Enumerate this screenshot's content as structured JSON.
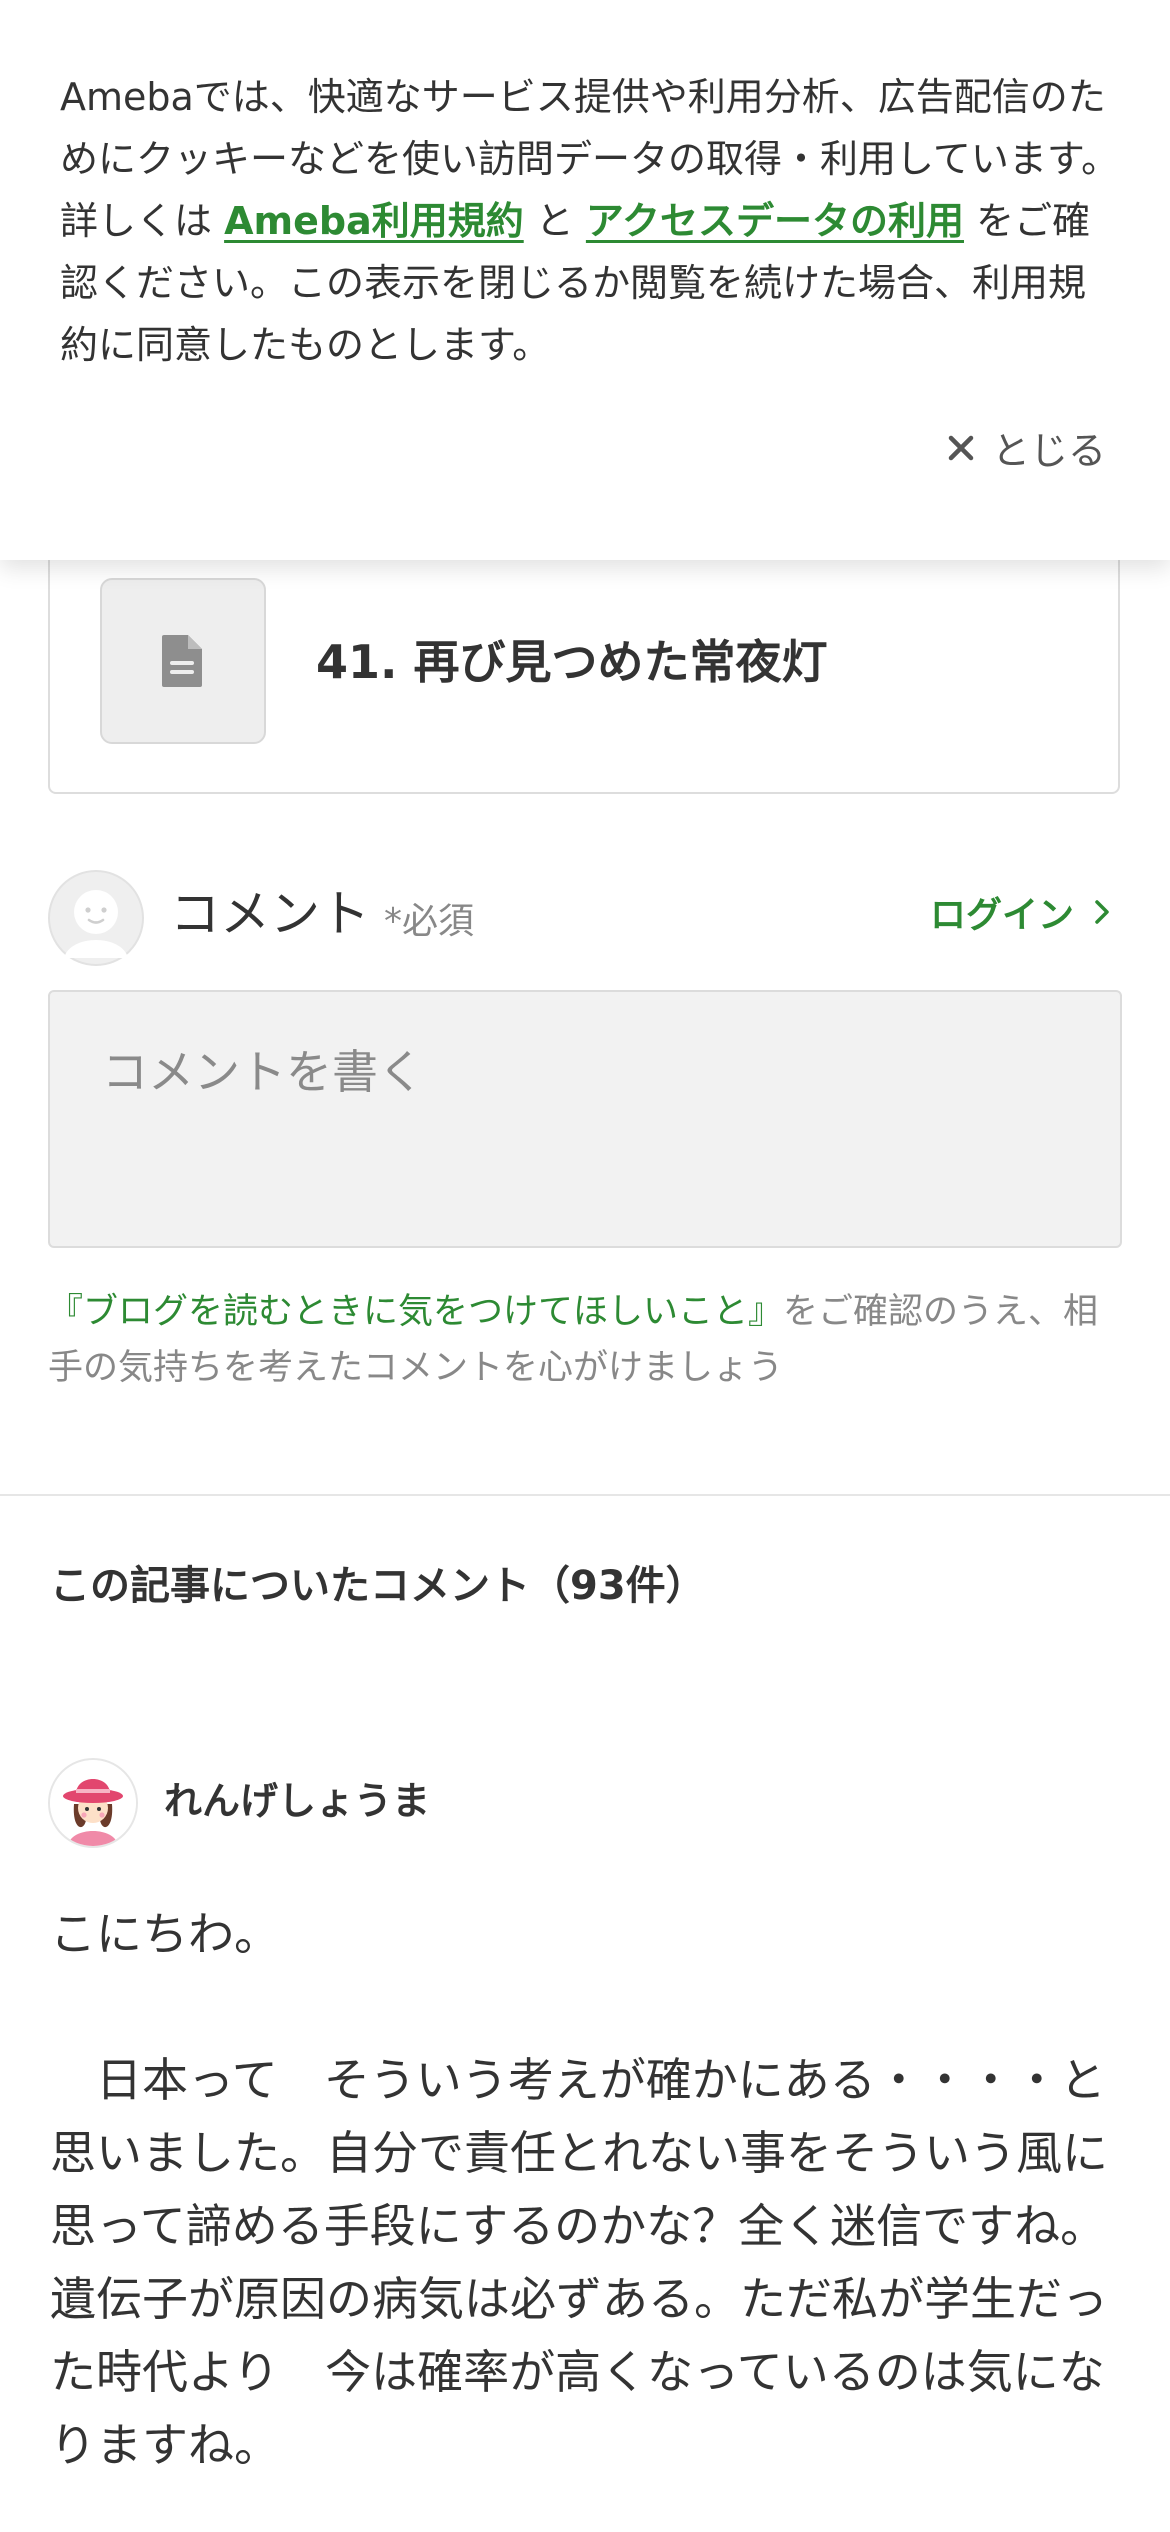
{
  "cookie_banner": {
    "text_before": "Amebaでは、快適なサービス提供や利用分析、広告配信のためにクッキーなどを使い訪問データの取得・利用しています。詳しくは ",
    "terms_link": "Ameba利用規約",
    "text_middle": " と ",
    "data_link": "アクセスデータの利用",
    "text_after": " をご確認ください。この表示を閉じるか閲覧を続けた場合、利用規約に同意したものとします。",
    "close_label": "とじる"
  },
  "related_article": {
    "title": "41. 再び見つめた常夜灯",
    "icon": "document-icon"
  },
  "comment_form": {
    "label": "コメント",
    "required": "*必須",
    "login": "ログイン",
    "placeholder": "コメントを書く",
    "notice_link": "『ブログを読むときに気をつけてほしいこと』",
    "notice_text": "をご確認のうえ、相手の気持ちを考えたコメントを心がけましょう"
  },
  "comments_section": {
    "title": "この記事についたコメント（93件）",
    "comments": [
      {
        "author": "れんげしょうま",
        "body": "こにちわ。\n\n　日本って　そういう考えが確かにある・・・・と思いました。自分で責任とれない事をそういう風に思って諦める手段にするのかな？全く迷信ですね。遺伝子が原因の病気は必ずある。ただ私が学生だった時代より　今は確率が高くなっているのは気になりますね。"
      }
    ]
  },
  "colors": {
    "accent_green": "#2d8a33",
    "text": "#333333",
    "muted": "#888888"
  }
}
